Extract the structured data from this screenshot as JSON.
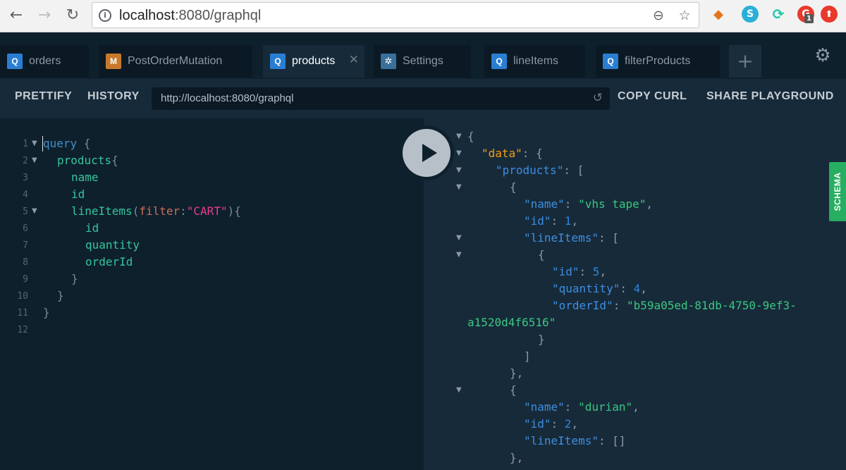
{
  "browser": {
    "url_host": "localhost",
    "url_path": ":8080/graphql",
    "extension_badge": "1"
  },
  "tabs": [
    {
      "tag": "Q",
      "label": "orders"
    },
    {
      "tag": "M",
      "label": "PostOrderMutation"
    },
    {
      "tag": "Q",
      "label": "products"
    },
    {
      "tag": "gear-icon",
      "label": "Settings"
    },
    {
      "tag": "Q",
      "label": "lineItems"
    },
    {
      "tag": "Q",
      "label": "filterProducts"
    }
  ],
  "toolbar": {
    "prettify": "PRETTIFY",
    "history": "HISTORY",
    "endpoint": "http://localhost:8080/graphql",
    "copy_curl": "COPY CURL",
    "share": "SHARE PLAYGROUND"
  },
  "schema_tab": "SCHEMA",
  "editor": {
    "line_numbers": [
      "1",
      "2",
      "3",
      "4",
      "5",
      "6",
      "7",
      "8",
      "9",
      "10",
      "11",
      "12"
    ],
    "query": {
      "keyword": "query",
      "open": " {",
      "products": "products",
      "brace": "{",
      "name": "name",
      "id": "id",
      "line_items": "lineItems",
      "paren_open": "(",
      "filter_arg": "filter",
      "colon": ":",
      "filter_value": "\"CART\"",
      "paren_close": "){",
      "li_id": "id",
      "quantity": "quantity",
      "order_id": "orderId",
      "close": "}"
    }
  },
  "result": {
    "open_brace": "{",
    "data_key": "\"data\"",
    "products_key": "\"products\"",
    "products": [
      {
        "name_key": "\"name\"",
        "name": "\"vhs tape\"",
        "id_key": "\"id\"",
        "id": "1",
        "line_items_key": "\"lineItems\"",
        "line_item": {
          "id_key": "\"id\"",
          "id": "5",
          "quantity_key": "\"quantity\"",
          "quantity": "4",
          "order_id_key": "\"orderId\"",
          "order_id_part1": "\"b59a05ed-81db-4750-9ef3-",
          "order_id_part2": "a1520d4f6516\""
        }
      },
      {
        "name_key": "\"name\"",
        "name": "\"durian\"",
        "id_key": "\"id\"",
        "id": "2",
        "line_items_key": "\"lineItems\"",
        "line_items_empty": "[]"
      }
    ]
  }
}
